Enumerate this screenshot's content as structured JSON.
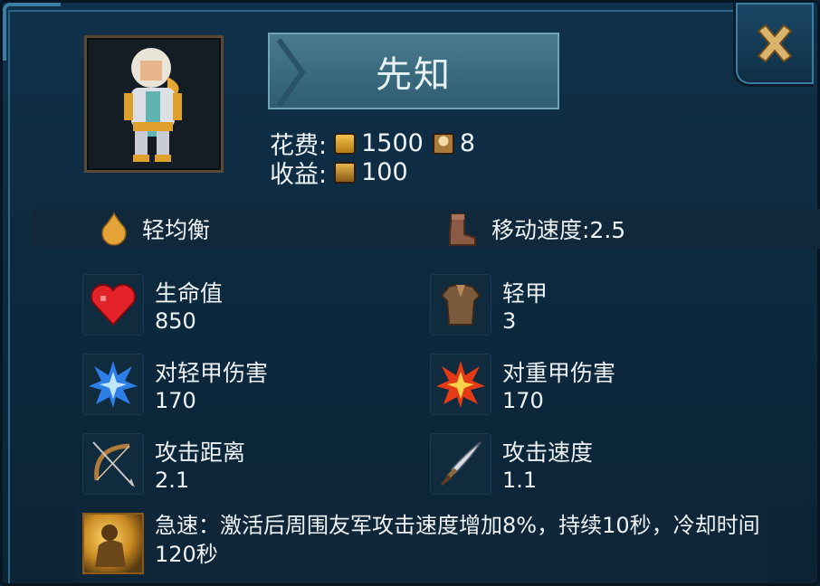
{
  "unit": {
    "name": "先知",
    "cost_label": "花费:",
    "cost_gold": "1500",
    "cost_pop": "8",
    "income_label": "收益:",
    "income_gold": "100"
  },
  "traits": {
    "armor_class": "轻均衡",
    "move_speed": "移动速度:2.5"
  },
  "stats": [
    {
      "label": "生命值",
      "value": "850"
    },
    {
      "label": "轻甲",
      "value": "3"
    },
    {
      "label": "对轻甲伤害",
      "value": "170"
    },
    {
      "label": "对重甲伤害",
      "value": "170"
    },
    {
      "label": "攻击距离",
      "value": "2.1"
    },
    {
      "label": "攻击速度",
      "value": "1.1"
    }
  ],
  "skill": {
    "description": "急速：激活后周围友军攻击速度增加8%，持续10秒，冷却时间120秒"
  },
  "colors": {
    "panel_bg": "#0d2a40",
    "name_button": "#3f6f83",
    "gold": "#e2a93a",
    "text": "#eef3f6"
  },
  "icons": {
    "close": "close-x-icon",
    "gold": "gold-coin-icon",
    "population": "population-icon",
    "income": "income-icon",
    "armor_class": "balance-drop-icon",
    "move_speed": "boot-icon",
    "hp": "heart-icon",
    "armor": "light-armor-icon",
    "dmg_light": "blue-burst-icon",
    "dmg_heavy": "fire-burst-icon",
    "range": "bow-icon",
    "atk_speed": "dagger-icon",
    "skill": "haste-skill-icon"
  }
}
